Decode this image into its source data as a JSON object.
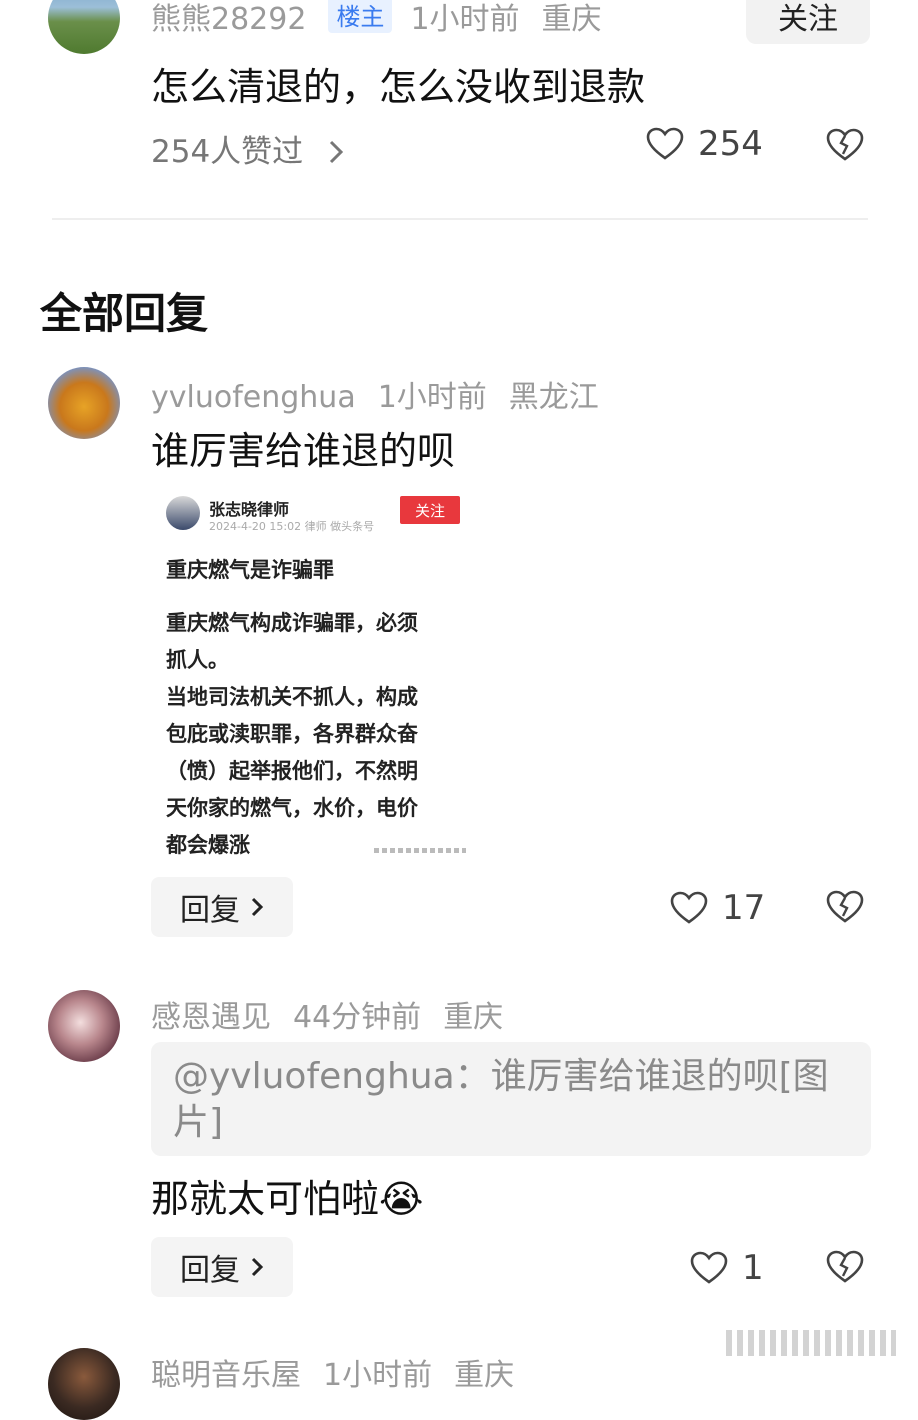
{
  "op": {
    "username": "熊熊28292",
    "badge": "楼主",
    "time": "1小时前",
    "location": "重庆",
    "follow_label": "关注",
    "content": "怎么清退的，怎么没收到退款",
    "likers_text": "254人赞过",
    "like_count": "254"
  },
  "section_title": "全部回复",
  "replies": [
    {
      "username": "yvluofenghua",
      "time": "1小时前",
      "location": "黑龙江",
      "content": "谁厉害给谁退的呗",
      "reply_label": "回复",
      "like_count": "17",
      "image": {
        "author": "张志晓律师",
        "subtitle": "2024-4-20 15:02 律师 做头条号",
        "follow": "关注",
        "title": "重庆燃气是诈骗罪",
        "lines": [
          "重庆燃气构成诈骗罪，必须",
          "抓人。",
          "当地司法机关不抓人，构成",
          "包庇或渎职罪，各界群众奋",
          "（愤）起举报他们，不然明",
          "天你家的燃气，水价，电价",
          "都会爆涨"
        ]
      }
    },
    {
      "username": "感恩遇见",
      "time": "44分钟前",
      "location": "重庆",
      "quote": "@yvluofenghua：谁厉害给谁退的呗[图片]",
      "content": "那就太可怕啦😭",
      "reply_label": "回复",
      "like_count": "1"
    },
    {
      "username": "聪明音乐屋",
      "time": "1小时前",
      "location": "重庆"
    }
  ],
  "colors": {
    "badge_bg": "#e8f1ff",
    "badge_text": "#3a7bef",
    "follow_red": "#e8383d"
  }
}
